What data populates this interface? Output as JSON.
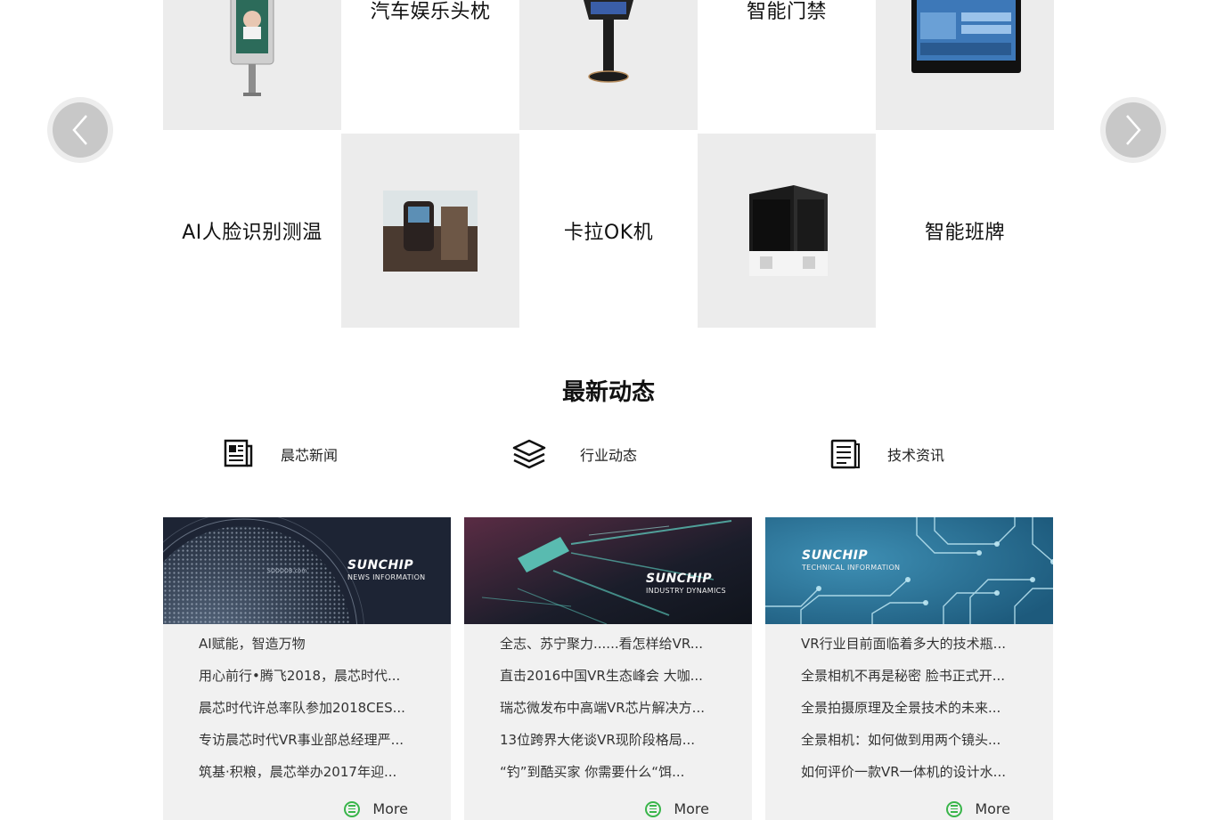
{
  "products": {
    "row1": [
      {
        "type": "image",
        "icon": "face-recognition-kiosk-image"
      },
      {
        "type": "label",
        "label": "汽车娱乐头枕"
      },
      {
        "type": "image",
        "icon": "karaoke-stand-image"
      },
      {
        "type": "label",
        "label": "智能门禁"
      },
      {
        "type": "image",
        "icon": "smart-class-board-image"
      }
    ],
    "row2": [
      {
        "type": "label",
        "label": "AI人脸识别测温"
      },
      {
        "type": "image",
        "icon": "car-headrest-screen-image"
      },
      {
        "type": "label",
        "label": "卡拉OK机"
      },
      {
        "type": "image",
        "icon": "access-control-device-image"
      },
      {
        "type": "label",
        "label": "智能班牌"
      }
    ]
  },
  "news": {
    "title": "最新动态",
    "tabs": [
      {
        "label": "晨芯新闻",
        "icon": "newspaper-icon"
      },
      {
        "label": "行业动态",
        "icon": "layers-icon"
      },
      {
        "label": "技术资讯",
        "icon": "document-icon"
      }
    ],
    "cards": [
      {
        "brand": "SUNCHIP",
        "subtitle": "NEWS INFORMATION",
        "watermark": "SOOOOB.com",
        "items": [
          "AI赋能，智造万物",
          "用心前行•腾飞2018，晨芯时代...",
          "晨芯时代许总率队参加2018CES...",
          "专访晨芯时代VR事业部总经理严...",
          "筑基·积粮，晨芯举办2017年迎..."
        ],
        "more": "More"
      },
      {
        "brand": "SUNCHIP",
        "subtitle": "INDUSTRY DYNAMICS",
        "items": [
          "全志、苏宁聚力......看怎样给VR...",
          "直击2016中国VR生态峰会 大咖...",
          "瑞芯微发布中高端VR芯片解决方...",
          "13位跨界大佬谈VR现阶段格局...",
          "“钓”到酷买家 你需要什么“饵..."
        ],
        "more": "More"
      },
      {
        "brand": "SUNCHIP",
        "subtitle": "TECHNICAL INFORMATION",
        "items": [
          "VR行业目前面临着多大的技术瓶...",
          "全景相机不再是秘密 脸书正式开...",
          "全景拍摄原理及全景技术的未来...",
          "全景相机：如何做到用两个镜头...",
          "如何评价一款VR一体机的设计水..."
        ],
        "more": "More"
      }
    ]
  },
  "colors": {
    "accent": "#39b54a",
    "cell_gray": "#ececec",
    "card_bg": "#f1f1f1"
  }
}
